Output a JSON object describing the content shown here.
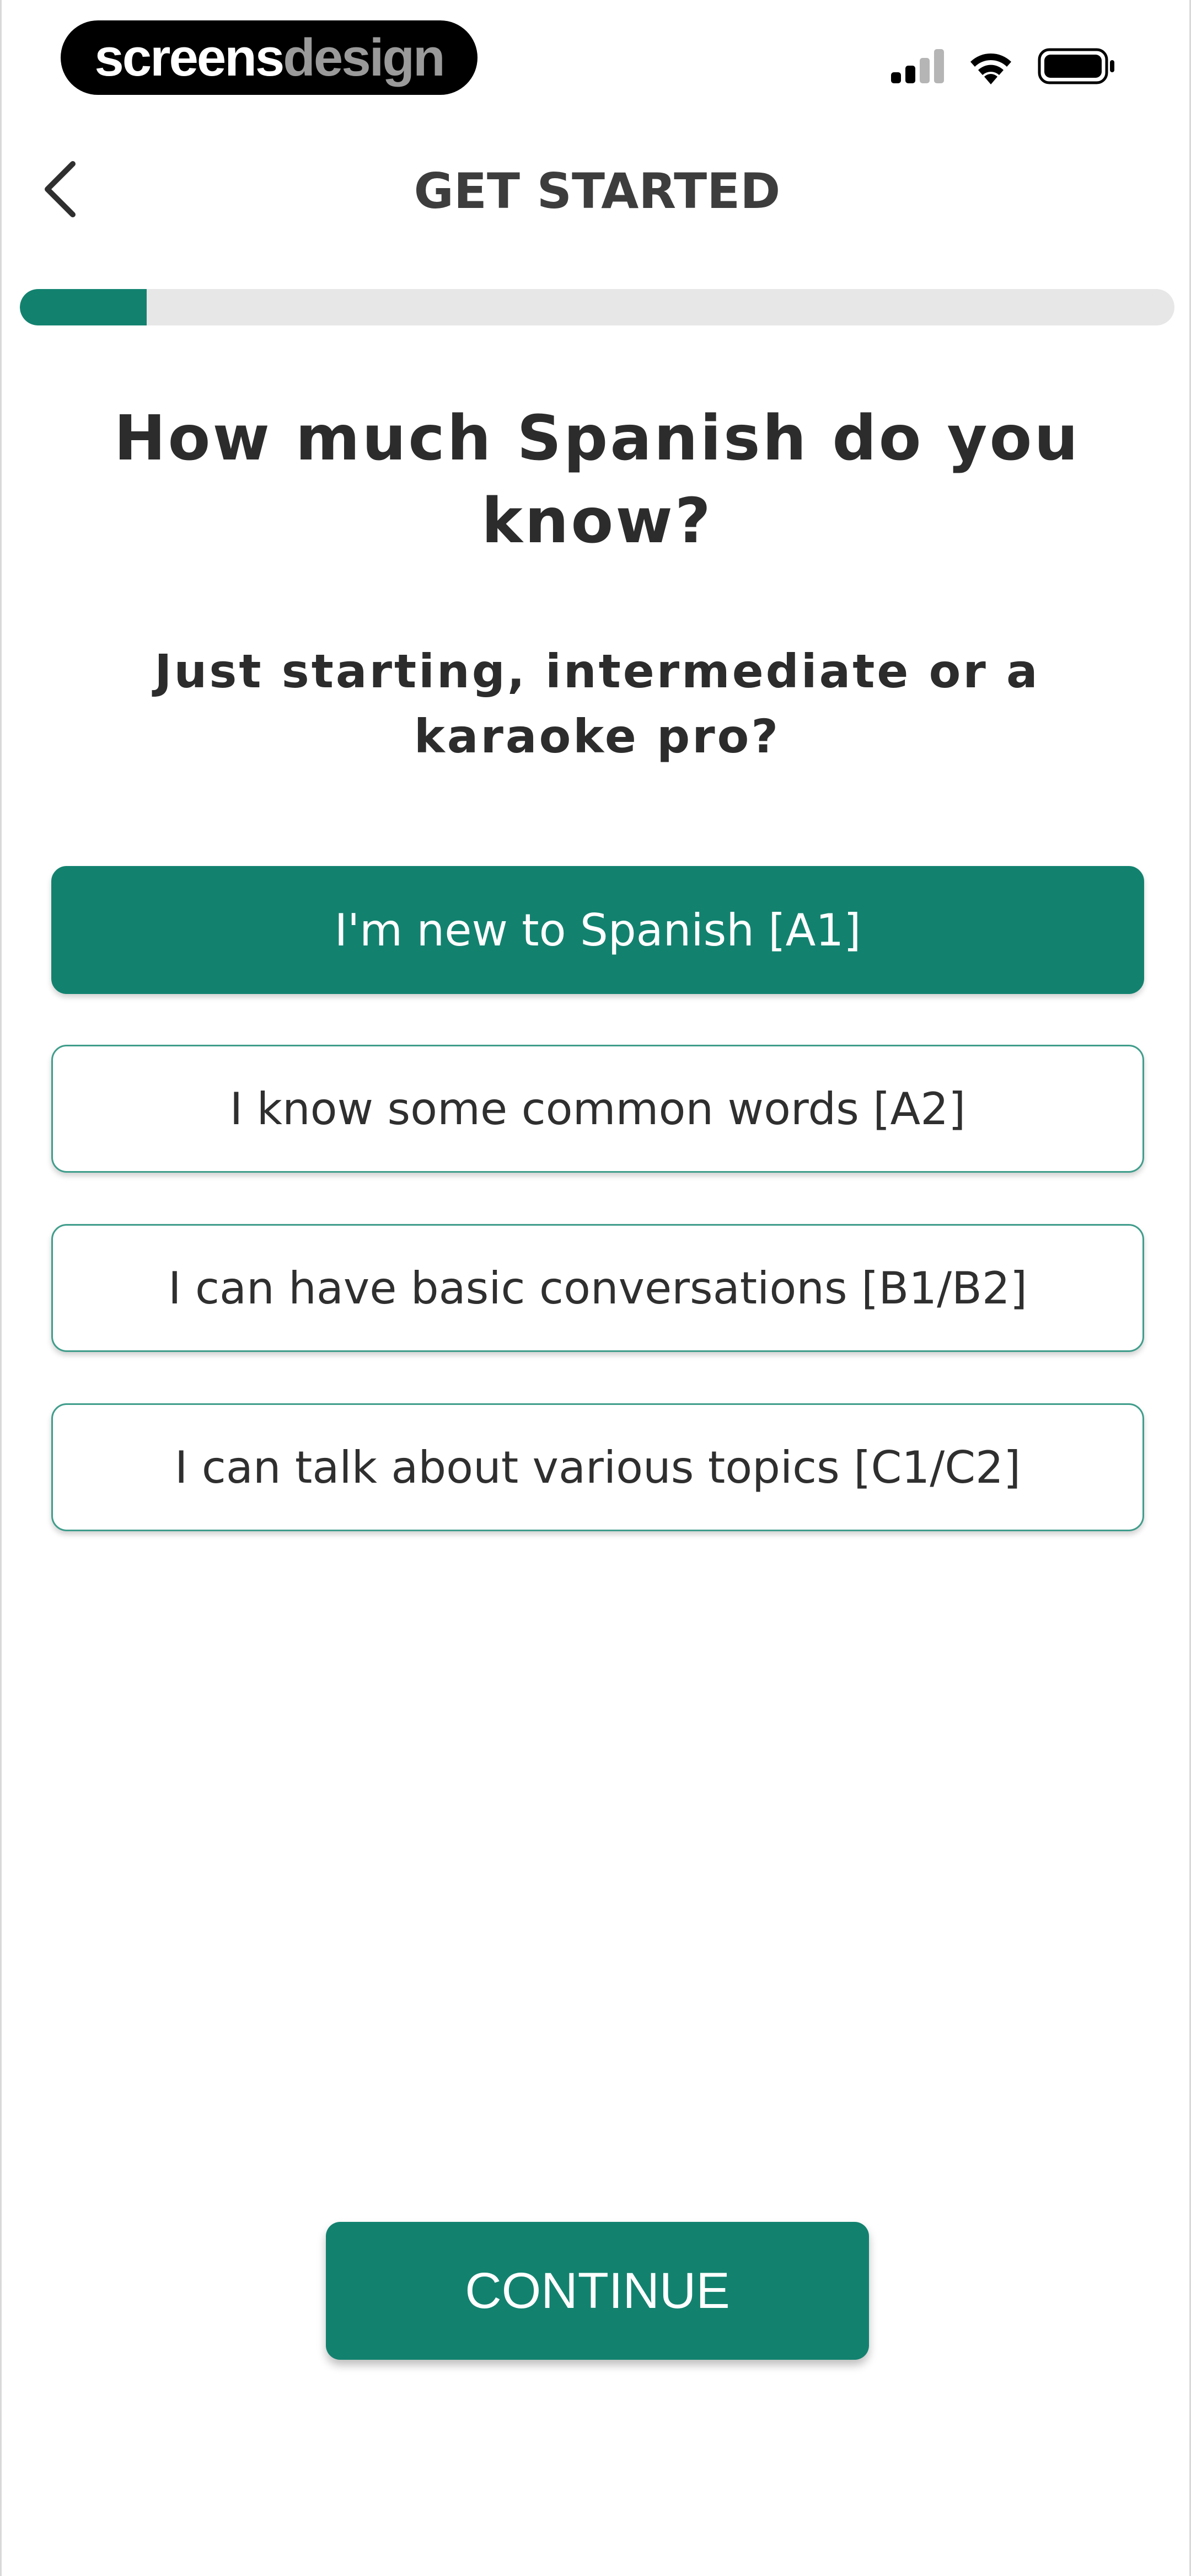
{
  "status_bar": {
    "logo_part1": "screens",
    "logo_part2": "design",
    "icons": [
      "signal-icon",
      "wifi-icon",
      "battery-icon"
    ]
  },
  "header": {
    "back_icon": "chevron-left-icon",
    "title": "GET STARTED"
  },
  "progress": {
    "fraction": 0.11,
    "fill_color": "#12826f",
    "track_color": "#e7e7e7"
  },
  "question": {
    "title": "How much Spanish do you know?",
    "subtitle": "Just starting, intermediate or a karaoke pro?"
  },
  "options": [
    {
      "label": "I'm new to Spanish [A1]",
      "selected": true
    },
    {
      "label": "I know some common words [A2]",
      "selected": false
    },
    {
      "label": "I can have basic conversations [B1/B2]",
      "selected": false
    },
    {
      "label": "I can talk about various topics [C1/C2]",
      "selected": false
    }
  ],
  "continue_label": "CONTINUE",
  "colors": {
    "accent": "#12826f",
    "option_border": "#3f9d8b"
  }
}
